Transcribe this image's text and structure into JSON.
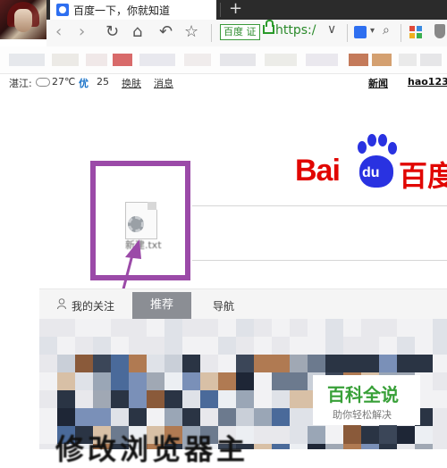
{
  "tab": {
    "title": "百度一下，你就知道",
    "new_tab_symbol": "+"
  },
  "toolbar": {
    "icons": [
      "back-icon",
      "forward-icon",
      "reload-icon",
      "home-icon",
      "undo-icon",
      "star-icon"
    ],
    "back": "‹",
    "forward": "›",
    "reload": "↻",
    "home": "⌂",
    "undo": "↶",
    "star": "☆",
    "cert_badge": "百度 证",
    "url": "https:/",
    "chevron": "∨",
    "search_arrow": "▾",
    "magnifier": "⌕"
  },
  "infobar": {
    "location": "湛江:",
    "temperature": "27℃",
    "aqi_label": "优",
    "aqi_value": "25",
    "skin_link": "换肤",
    "message_link": "消息",
    "news_link": "新闻",
    "hao123_link": "hao123"
  },
  "logo": {
    "latin": "Bai",
    "paw_text": "du",
    "chinese": "百度"
  },
  "desktop_file": {
    "label": "新建.txt"
  },
  "feed": {
    "tabs": [
      {
        "label": "我的关注"
      },
      {
        "label": "推荐"
      },
      {
        "label": "导航"
      }
    ],
    "active_tab": "推荐"
  },
  "watermark": {
    "title": "百科全说",
    "subtitle": "助你轻松解决"
  },
  "headline": "修改浏览器主",
  "colors": {
    "annotation_purple": "#9b4aa8",
    "baidu_red": "#e10601",
    "baidu_blue": "#2932e1",
    "url_green": "#2a8a2a"
  }
}
